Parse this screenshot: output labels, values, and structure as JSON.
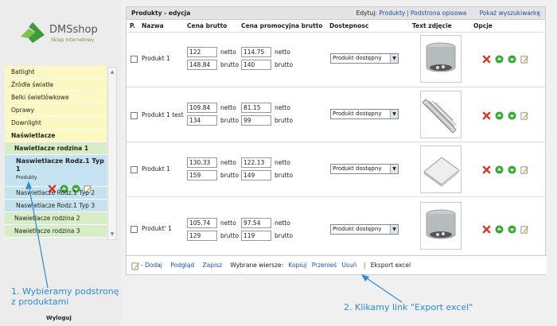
{
  "logo": {
    "name": "DMSshop",
    "subtitle": "Sklep Internetowy"
  },
  "sidebar": {
    "items": [
      {
        "label": "Batlight"
      },
      {
        "label": "Źródła światła"
      },
      {
        "label": "Belki świetlówkowe"
      },
      {
        "label": "Oprawy"
      },
      {
        "label": "Downlight"
      },
      {
        "label": "Naświetlacze"
      },
      {
        "label": "Nawietlacze rodzina 1"
      },
      {
        "label": "Naswietlacze Rodz.1 Typ 1",
        "sub": "Produkty"
      },
      {
        "label": "Naswietlacze Rodz.1 Typ 2"
      },
      {
        "label": "Naswietlacze Rodz.1 Typ 3"
      },
      {
        "label": "Nawietlacze rodzina 2"
      },
      {
        "label": "Nawietlacze rodzina 3"
      }
    ],
    "logout": "Wyloguj"
  },
  "header": {
    "title": "Produkty - edycja",
    "edit_label": "Edytuj:",
    "products_link": "Produkty",
    "subpage_link": "Podstrona opisowa",
    "show_search": "Pokaż wyszukiwarkę"
  },
  "columns": [
    "P.",
    "Nazwa",
    "Cena brutto",
    "Cena promocyjna brutto",
    "Dostepnosc",
    "Text zdjęcie",
    "Opcje"
  ],
  "units": {
    "net": "netto",
    "gross": "brutto"
  },
  "rows": [
    {
      "name": "Produkt 1",
      "price_net": "122",
      "price_gross": "148.84",
      "promo_net": "114.75",
      "promo_gross": "140",
      "availability": "Produkt dostępny",
      "image": "downlight"
    },
    {
      "name": "Produkt 1 test",
      "price_net": "109.84",
      "price_gross": "134",
      "promo_net": "81.15",
      "promo_gross": "99",
      "availability": "Produkt dostępny",
      "image": "louver"
    },
    {
      "name": "Produkt 1",
      "price_net": "130.33",
      "price_gross": "159",
      "promo_net": "122.13",
      "promo_gross": "149",
      "availability": "Produkt dostępny",
      "image": "panel"
    },
    {
      "name": "Produkt' 1",
      "price_net": "105.74",
      "price_gross": "129",
      "promo_net": "97.54",
      "promo_gross": "119",
      "availability": "Produkt dostępny",
      "image": "downlight"
    }
  ],
  "footer": {
    "add": "- Dodaj",
    "preview": "Podgląd",
    "save": "Zapisz",
    "selected_rows": "Wybrane wiersze:",
    "copy": "Kopiuj",
    "move": "Przenieś",
    "delete": "Usuń",
    "export": "Eksport excel"
  },
  "annotations": {
    "note1_line1": "1. Wybieramy podstronę",
    "note1_line2": "z produktami",
    "note2": "2. Klikamy link \"Export excel\""
  },
  "colors": {
    "link": "#1a4ea8",
    "annotation": "#2a8be2",
    "delete_icon": "#e0301e",
    "ok_icon": "#3aa832"
  }
}
